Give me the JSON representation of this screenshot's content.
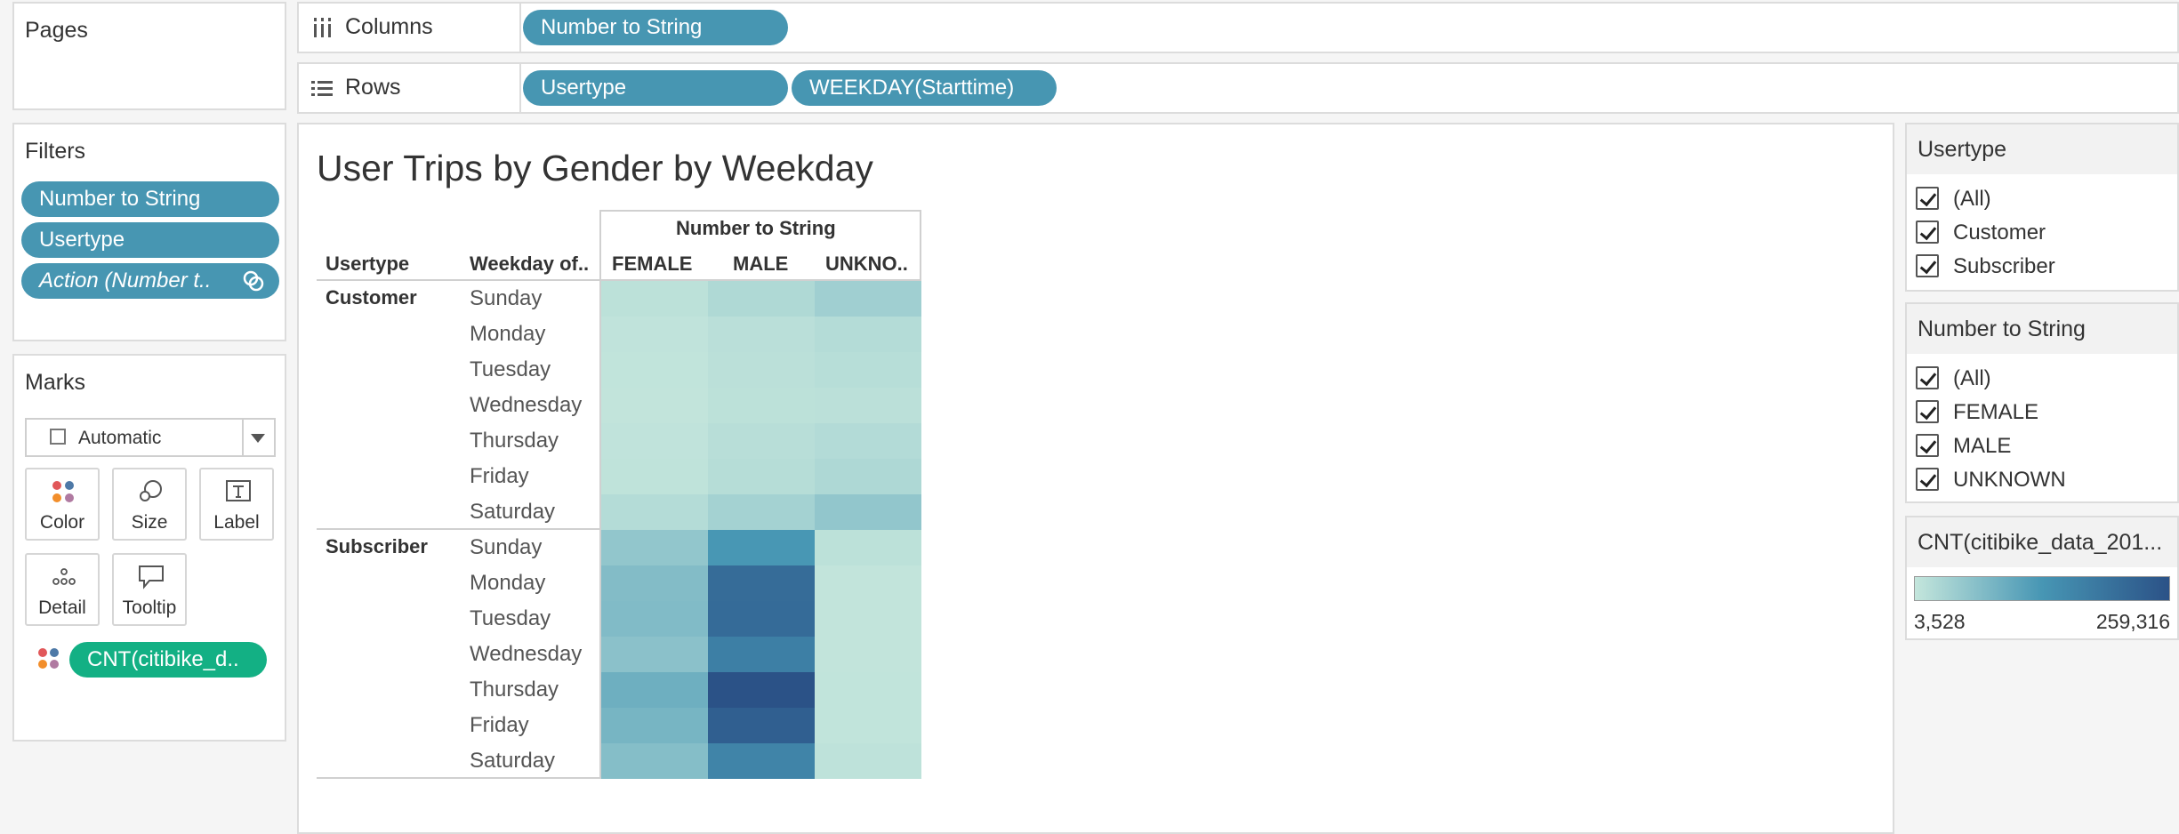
{
  "pages": {
    "title": "Pages"
  },
  "columns_shelf": {
    "label": "Columns",
    "pills": [
      "Number to String"
    ]
  },
  "rows_shelf": {
    "label": "Rows",
    "pills": [
      "Usertype",
      "WEEKDAY(Starttime)"
    ]
  },
  "filters": {
    "title": "Filters",
    "pills": [
      "Number to String",
      "Usertype",
      "Action (Number t.."
    ]
  },
  "marks": {
    "title": "Marks",
    "type_select": "Automatic",
    "buttons": [
      "Color",
      "Size",
      "Label",
      "Detail",
      "Tooltip"
    ],
    "measure_pill": "CNT(citibike_d.."
  },
  "view": {
    "title": "User Trips by Gender by Weekday",
    "column_field_header": "Number to String",
    "row_headers": [
      "Usertype",
      "Weekday of.."
    ],
    "columns": [
      "FEMALE",
      "MALE",
      "UNKNO.."
    ],
    "groups": [
      {
        "label": "Customer",
        "days": [
          "Sunday",
          "Monday",
          "Tuesday",
          "Wednesday",
          "Thursday",
          "Friday",
          "Saturday"
        ]
      },
      {
        "label": "Subscriber",
        "days": [
          "Sunday",
          "Monday",
          "Tuesday",
          "Wednesday",
          "Thursday",
          "Friday",
          "Saturday"
        ]
      }
    ]
  },
  "chart_data": {
    "type": "heatmap",
    "title": "User Trips by Gender by Weekday",
    "x_field": "Number to String",
    "x": [
      "FEMALE",
      "MALE",
      "UNKNO.."
    ],
    "y": [
      "Customer / Sunday",
      "Customer / Monday",
      "Customer / Tuesday",
      "Customer / Wednesday",
      "Customer / Thursday",
      "Customer / Friday",
      "Customer / Saturday",
      "Subscriber / Sunday",
      "Subscriber / Monday",
      "Subscriber / Tuesday",
      "Subscriber / Wednesday",
      "Subscriber / Thursday",
      "Subscriber / Friday",
      "Subscriber / Saturday"
    ],
    "values": [
      [
        12000,
        25000,
        40000
      ],
      [
        8000,
        14000,
        20000
      ],
      [
        7000,
        13000,
        17000
      ],
      [
        6000,
        12000,
        13000
      ],
      [
        8000,
        16000,
        21000
      ],
      [
        9000,
        18000,
        26000
      ],
      [
        20000,
        36000,
        55000
      ],
      [
        55000,
        130000,
        12000
      ],
      [
        70000,
        210000,
        6000
      ],
      [
        72000,
        212000,
        6000
      ],
      [
        62000,
        175000,
        6000
      ],
      [
        92000,
        259316,
        7000
      ],
      [
        82000,
        235000,
        7000
      ],
      [
        68000,
        165000,
        10000
      ]
    ],
    "color_range": [
      3528,
      259316
    ],
    "color_min_hex": "#c4e6dc",
    "color_max_hex": "#2b5287"
  },
  "right_filters": {
    "usertype": {
      "title": "Usertype",
      "options": [
        "(All)",
        "Customer",
        "Subscriber"
      ]
    },
    "number_to_string": {
      "title": "Number to String",
      "options": [
        "(All)",
        "FEMALE",
        "MALE",
        "UNKNOWN"
      ]
    }
  },
  "legend": {
    "title": "CNT(citibike_data_201...",
    "min_label": "3,528",
    "max_label": "259,316"
  }
}
